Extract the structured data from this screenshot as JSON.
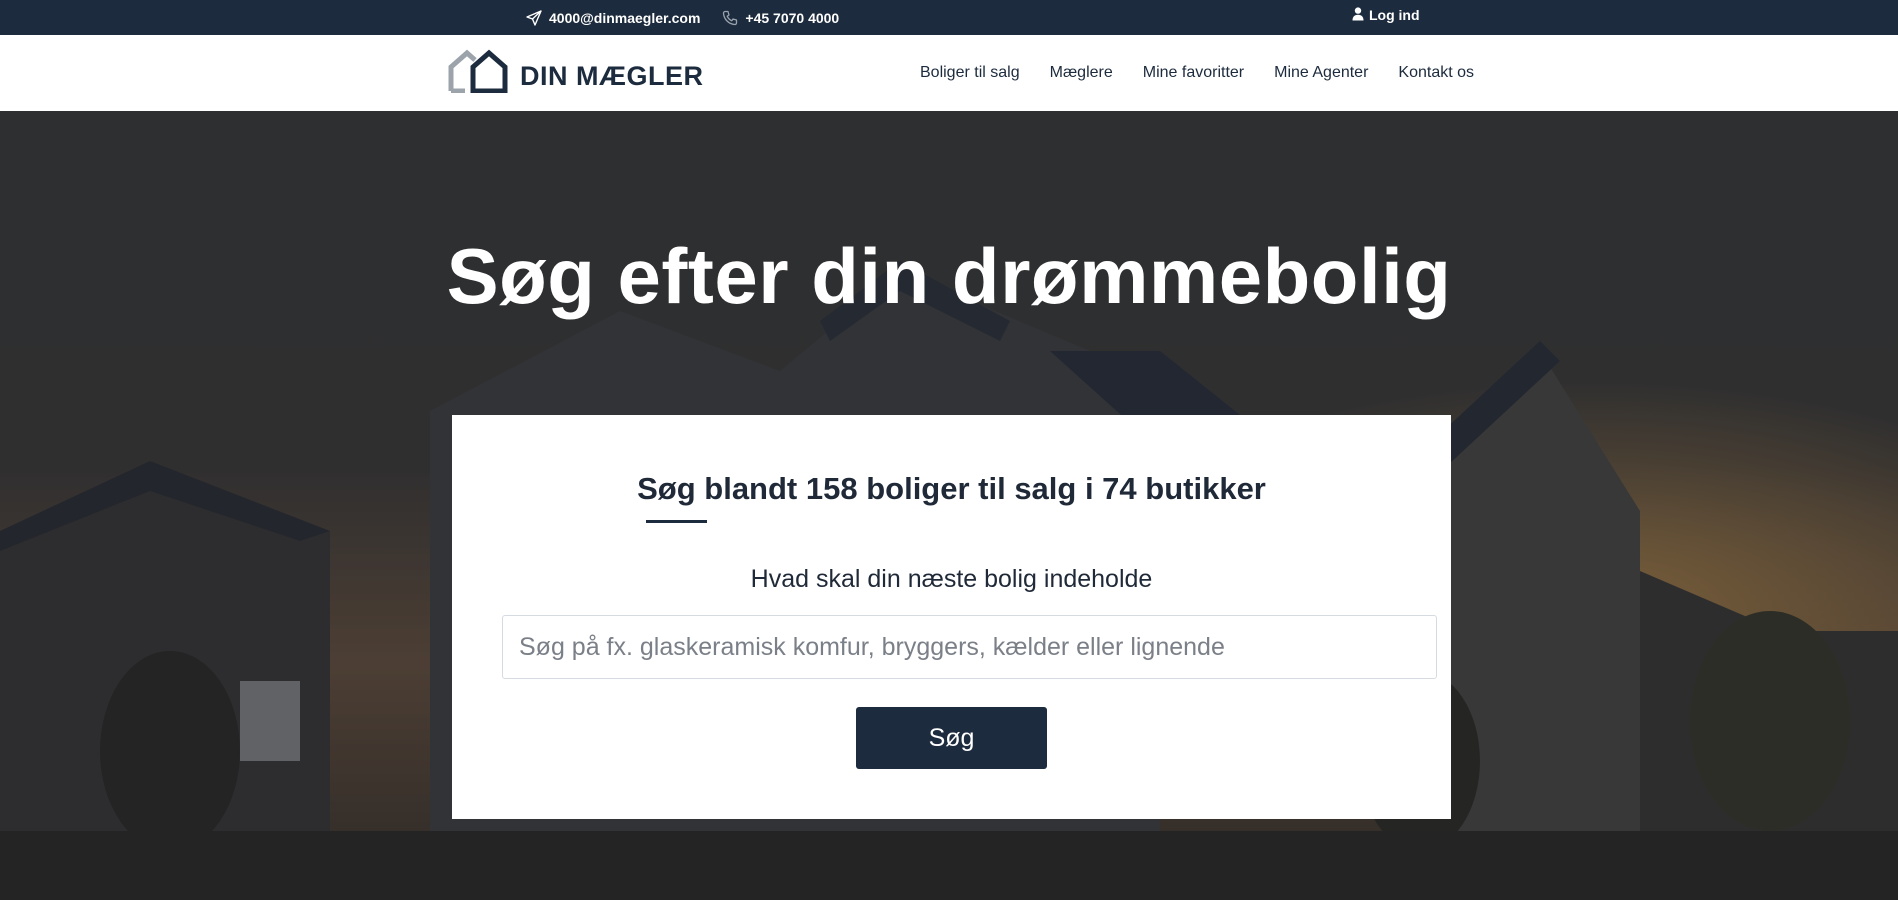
{
  "topbar": {
    "email": "4000@dinmaegler.com",
    "phone": "+45 7070 4000",
    "login_label": "Log ind",
    "icons": {
      "email": "paper-plane-icon",
      "phone": "phone-icon",
      "login": "user-icon"
    }
  },
  "navbar": {
    "brand": "DIN MÆGLER",
    "links": [
      "Boliger til salg",
      "Mæglere",
      "Mine favoritter",
      "Mine Agenter",
      "Kontakt os"
    ]
  },
  "hero": {
    "title": "Søg efter din drømmebolig"
  },
  "search_card": {
    "title": "Søg blandt 158 boliger til salg i 74 butikker",
    "subtitle": "Hvad skal din næste bolig indeholde",
    "placeholder": "Søg på fx. glaskeramisk komfur, bryggers, kælder eller lignende",
    "value": "",
    "button_label": "Søg"
  },
  "colors": {
    "primary": "#1c2b3d",
    "topbar_bg": "#1c2b3d",
    "white": "#ffffff"
  }
}
